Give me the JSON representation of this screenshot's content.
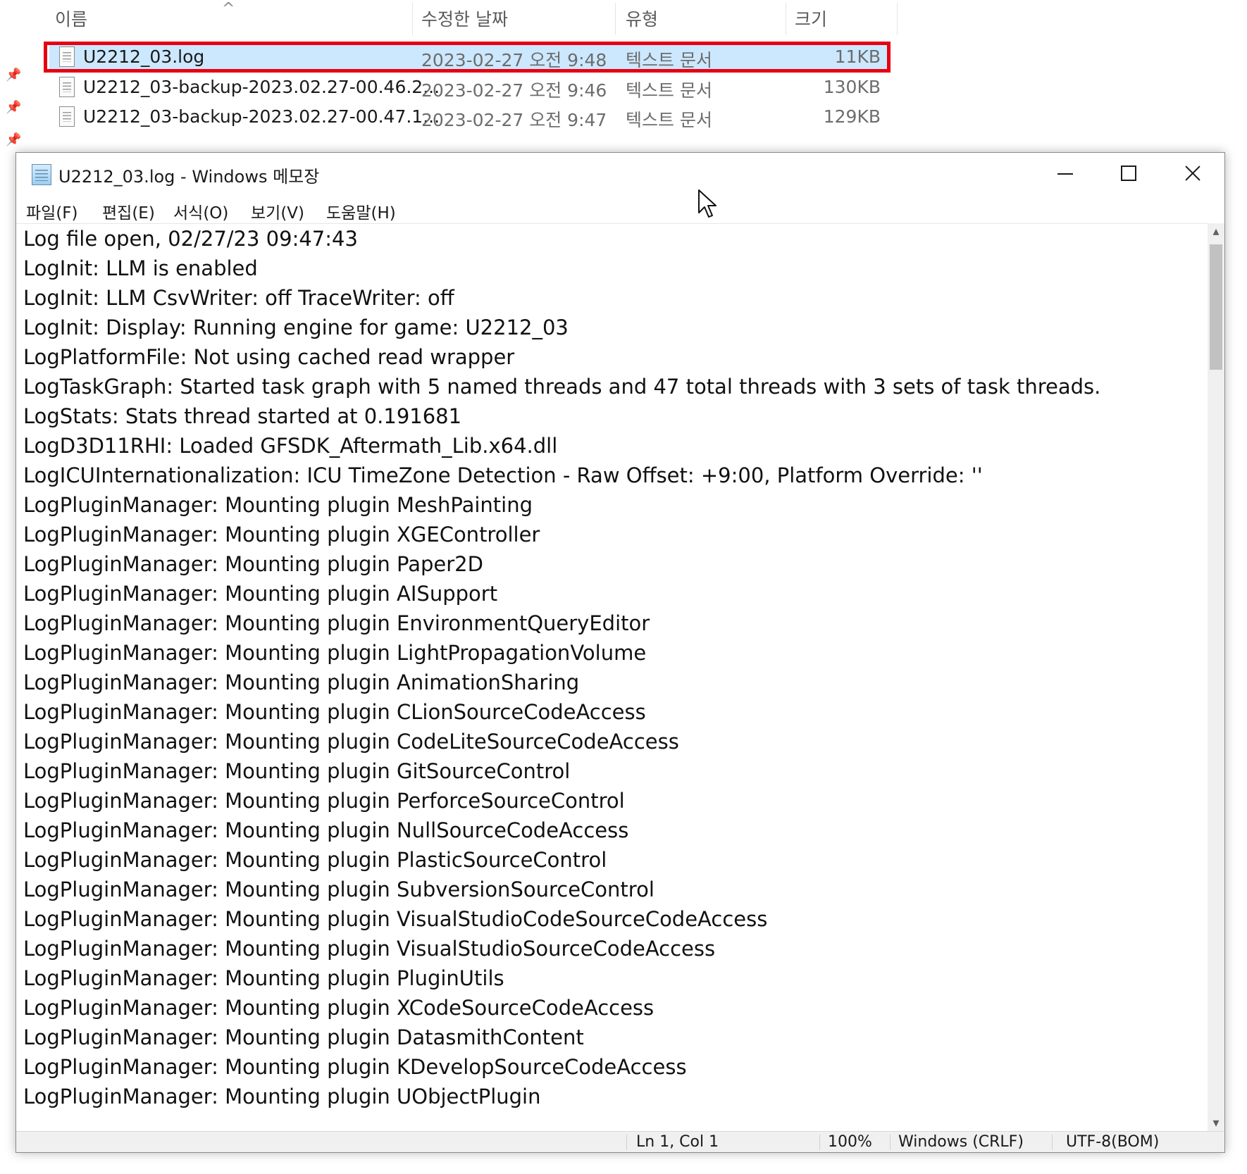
{
  "explorer": {
    "columns": {
      "name": "이름",
      "modified": "수정한 날짜",
      "type": "유형",
      "size": "크기"
    },
    "sort_indicator": "^",
    "files": [
      {
        "name": "U2212_03.log",
        "modified": "2023-02-27 오전 9:48",
        "type": "텍스트 문서",
        "size": "11KB",
        "selected": true
      },
      {
        "name": "U2212_03-backup-2023.02.27-00.46.2...",
        "modified": "2023-02-27 오전 9:46",
        "type": "텍스트 문서",
        "size": "130KB"
      },
      {
        "name": "U2212_03-backup-2023.02.27-00.47.1...",
        "modified": "2023-02-27 오전 9:47",
        "type": "텍스트 문서",
        "size": "129KB"
      }
    ]
  },
  "notepad": {
    "title": "U2212_03.log - Windows 메모장",
    "menu": [
      "파일(F)",
      "편집(E)",
      "서식(O)",
      "보기(V)",
      "도움말(H)"
    ],
    "lines": [
      "Log file open, 02/27/23 09:47:43",
      "LogInit: LLM is enabled",
      "LogInit: LLM CsvWriter: off TraceWriter: off",
      "LogInit: Display: Running engine for game: U2212_03",
      "LogPlatformFile: Not using cached read wrapper",
      "LogTaskGraph: Started task graph with 5 named threads and 47 total threads with 3 sets of task threads.",
      "LogStats: Stats thread started at 0.191681",
      "LogD3D11RHI: Loaded GFSDK_Aftermath_Lib.x64.dll",
      "LogICUInternationalization: ICU TimeZone Detection - Raw Offset: +9:00, Platform Override: ''",
      "LogPluginManager: Mounting plugin MeshPainting",
      "LogPluginManager: Mounting plugin XGEController",
      "LogPluginManager: Mounting plugin Paper2D",
      "LogPluginManager: Mounting plugin AISupport",
      "LogPluginManager: Mounting plugin EnvironmentQueryEditor",
      "LogPluginManager: Mounting plugin LightPropagationVolume",
      "LogPluginManager: Mounting plugin AnimationSharing",
      "LogPluginManager: Mounting plugin CLionSourceCodeAccess",
      "LogPluginManager: Mounting plugin CodeLiteSourceCodeAccess",
      "LogPluginManager: Mounting plugin GitSourceControl",
      "LogPluginManager: Mounting plugin PerforceSourceControl",
      "LogPluginManager: Mounting plugin NullSourceCodeAccess",
      "LogPluginManager: Mounting plugin PlasticSourceControl",
      "LogPluginManager: Mounting plugin SubversionSourceControl",
      "LogPluginManager: Mounting plugin VisualStudioCodeSourceCodeAccess",
      "LogPluginManager: Mounting plugin VisualStudioSourceCodeAccess",
      "LogPluginManager: Mounting plugin PluginUtils",
      "LogPluginManager: Mounting plugin XCodeSourceCodeAccess",
      "LogPluginManager: Mounting plugin DatasmithContent",
      "LogPluginManager: Mounting plugin KDevelopSourceCodeAccess",
      "LogPluginManager: Mounting plugin UObjectPlugin"
    ],
    "status": {
      "position": "Ln 1, Col 1",
      "zoom": "100%",
      "line_ending": "Windows (CRLF)",
      "encoding": "UTF-8(BOM)"
    }
  },
  "colors": {
    "selection": "#cce8ff",
    "highlight_border": "#e60012"
  }
}
